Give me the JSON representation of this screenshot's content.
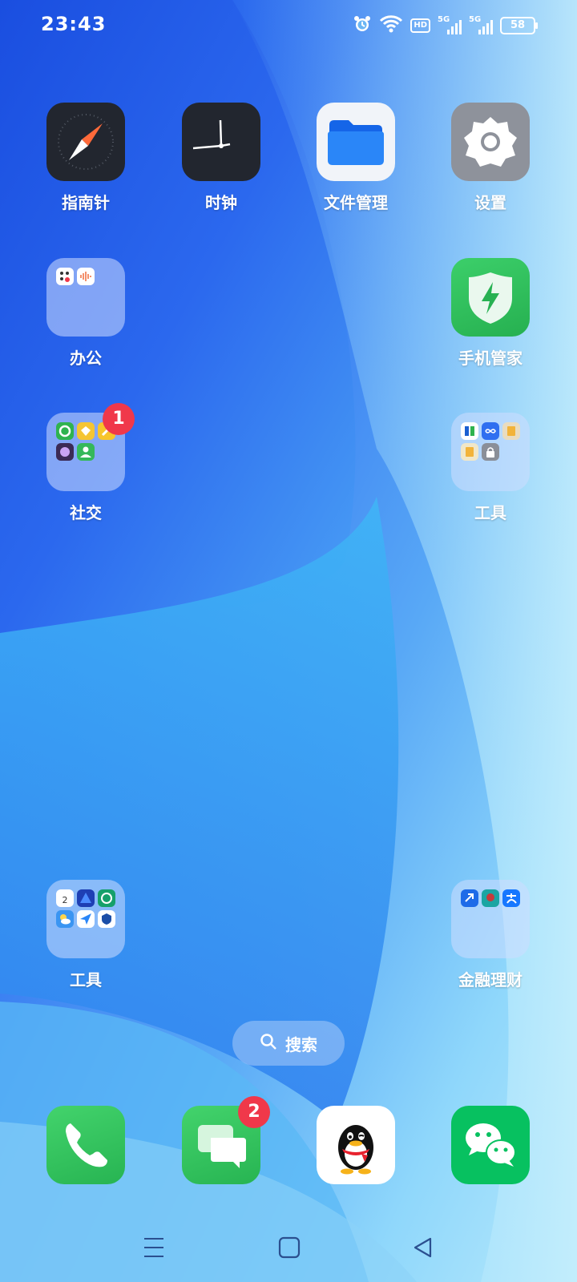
{
  "status_bar": {
    "time": "23:43",
    "hd_label": "HD",
    "sim1_label": "5G",
    "sim2_label": "5G",
    "battery": "58"
  },
  "apps": {
    "compass": "指南针",
    "clock": "时钟",
    "files": "文件管理",
    "settings": "设置",
    "office": "办公",
    "phone_manager": "手机管家",
    "social": "社交",
    "social_badge": "1",
    "tools1": "工具",
    "tools2": "工具",
    "finance": "金融理财"
  },
  "search": {
    "label": "搜索"
  },
  "dock": {
    "phone": "phone-icon",
    "messages": "messages-icon",
    "messages_badge": "2",
    "qq": "qq-icon",
    "wechat": "wechat-icon"
  },
  "colors": {
    "badge": "#f0384a",
    "wechat": "#07c160",
    "phone": "#34c759"
  }
}
